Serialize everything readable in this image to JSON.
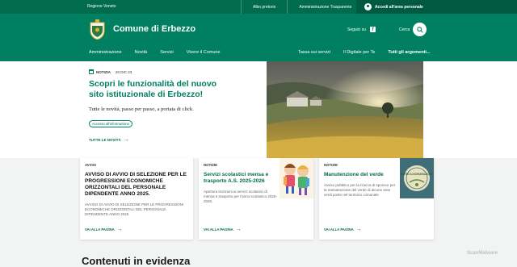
{
  "topbar": {
    "region": "Regione Veneto",
    "links": [
      "Albo pretorio",
      "Amministrazione Trasparente"
    ],
    "login": "Accedi all'area personale"
  },
  "header": {
    "site_title": "Comune di Erbezzo",
    "follow_label": "Seguici su",
    "search_label": "Cerca",
    "nav_left": [
      "Amministrazione",
      "Novità",
      "Servizi",
      "Vivere il Comune"
    ],
    "nav_right": [
      "Tassa sui servizi",
      "Il Digitale per Te",
      "Tutti gli argomenti..."
    ]
  },
  "hero": {
    "tag": "NOTIZIA",
    "date": "20 DIC 23",
    "title": "Scopri le funzionalità del nuovo sito istituzionale di Erbezzo!",
    "description": "Tutte le novità, passo per passo, a portata di click.",
    "pill": "Accesso all'informazione",
    "all_news": "TUTTE LE NOVITÀ"
  },
  "cards": [
    {
      "category": "AVVISI",
      "title": "AVVISO DI AVVIO DI SELEZIONE PER LE PROGRESSIONI ECONOMICHE ORIZZONTALI DEL PERSONALE DIPENDENTE ANNO 2025.",
      "body": "AVVISO DI AVVIO DI SELEZIONE PER LE PROGRESSIONI ECONOMICHE ORIZZONTALI DEL PERSONALE DIPENDENTE ANNO 2025.",
      "link": "VAI ALLA PAGINA"
    },
    {
      "category": "NOTIZIE",
      "title": "Servizi scolastici mensa e trasporto A.S. 2025-2026",
      "body": "Apertura iscrizioni ai servizi scolastici di mensa e trasporto per l'anno scolastico 2025-2026.",
      "link": "VAI ALLA PAGINA"
    },
    {
      "category": "NOTIZIE",
      "title": "Manutenzione del verde",
      "body": "Avviso pubblico per la ricerca di sponsor per la manutenzione del verde di alcune aree verdi poste nel territorio comunale",
      "link": "VAI ALLA PAGINA",
      "badge_text": "INVITO A DICHIARAZIONE"
    }
  ],
  "section_title": "Contenuti in evidenza",
  "watermark": "ScanMalware",
  "colors": {
    "primary": "#008060",
    "dark": "#006b4f"
  }
}
